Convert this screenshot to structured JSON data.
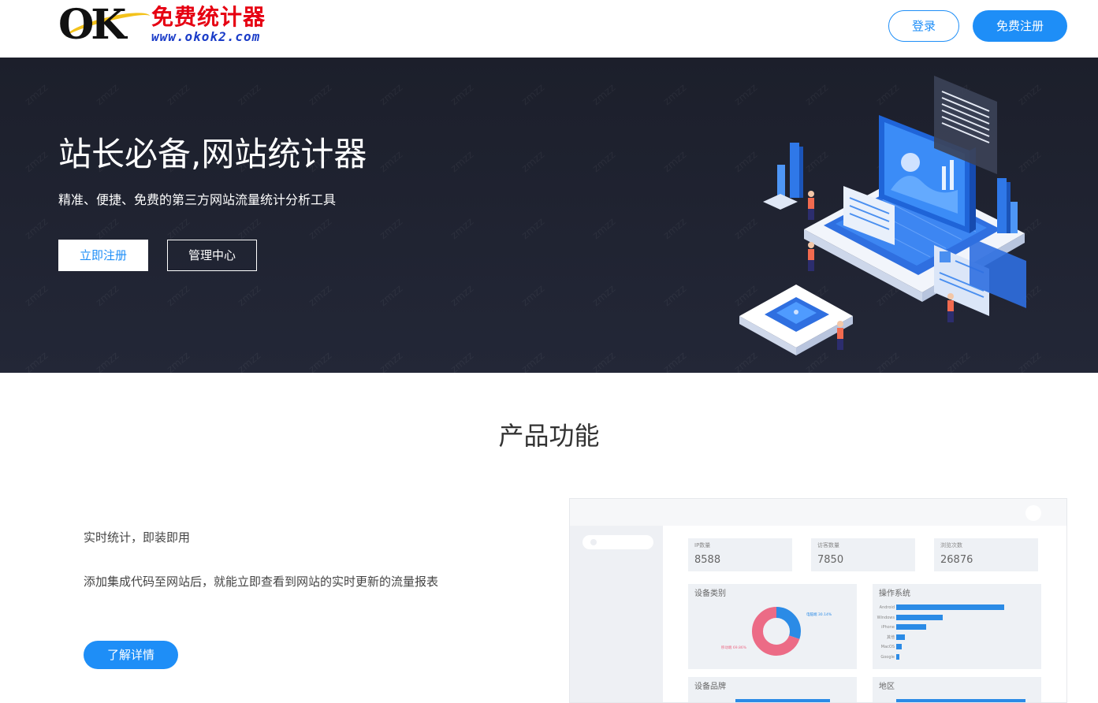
{
  "header": {
    "logo_text": "OK",
    "logo_cn": "免费统计器",
    "logo_url": "www.okok2.com",
    "login_label": "登录",
    "register_label": "免费注册"
  },
  "hero": {
    "title": "站长必备,网站统计器",
    "subtitle": "精准、便捷、免费的第三方网站流量统计分析工具",
    "btn_register": "立即注册",
    "btn_manage": "管理中心",
    "watermark": "zmzz"
  },
  "section": {
    "title": "产品功能"
  },
  "feature": {
    "title": "实时统计，即装即用",
    "desc": "添加集成代码至网站后，就能立即查看到网站的实时更新的流量报表",
    "button": "了解详情"
  },
  "dashboard": {
    "stats": [
      {
        "label": "IP数量",
        "value": "8588"
      },
      {
        "label": "访客数量",
        "value": "7850"
      },
      {
        "label": "浏览次数",
        "value": "26876"
      }
    ],
    "device_panel": {
      "title": "设备类别",
      "slices": [
        {
          "label": "电脑端 30.14%",
          "percent": 30.14,
          "color": "#2b8be6"
        },
        {
          "label": "移动端 69.86%",
          "percent": 69.86,
          "color": "#ec6b86"
        }
      ]
    },
    "os_panel": {
      "title": "操作系统",
      "bars": [
        {
          "label": "Android",
          "value": 100
        },
        {
          "label": "Windows",
          "value": 43
        },
        {
          "label": "iPhone",
          "value": 28
        },
        {
          "label": "其他",
          "value": 8
        },
        {
          "label": "MacOS",
          "value": 5
        },
        {
          "label": "Google",
          "value": 3
        }
      ]
    },
    "brand_panel": {
      "title": "设备品牌"
    },
    "region_panel": {
      "title": "地区"
    }
  },
  "colors": {
    "accent": "#1e8ef7",
    "hero_bg": "#1f2230",
    "logo_red": "#e60012",
    "logo_blue": "#1a3cc8"
  }
}
